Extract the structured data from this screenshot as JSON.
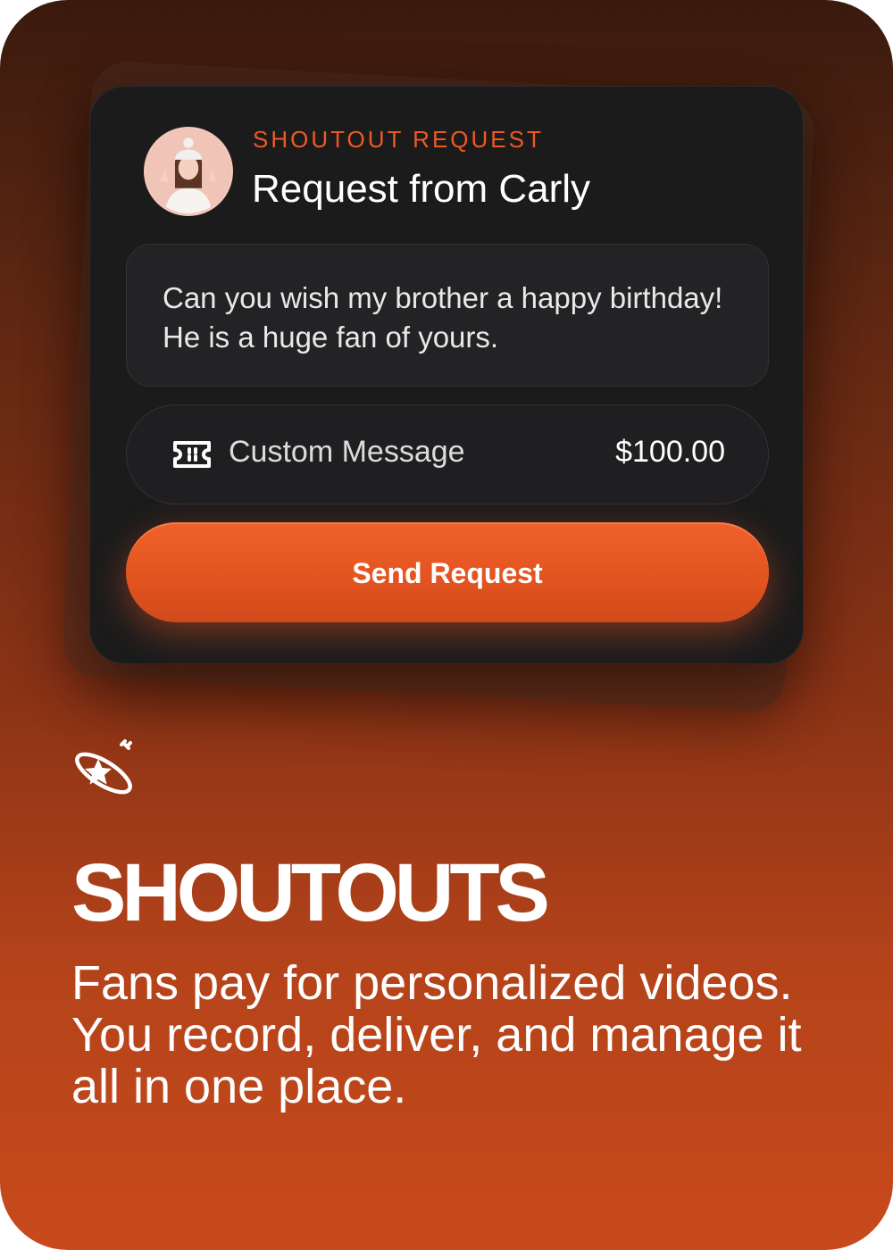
{
  "card": {
    "eyebrow": "SHOUTOUT REQUEST",
    "title": "Request from Carly",
    "message": "Can you wish my brother a happy birthday! He is a huge fan of yours.",
    "product": {
      "icon": "ticket-icon",
      "label": "Custom Message",
      "price": "$100.00"
    },
    "send_label": "Send Request"
  },
  "feature": {
    "icon": "star-orbit-icon",
    "title": "SHOUTOUTS",
    "description": "Fans pay for personalized videos. You record, deliver, and manage it all in one place."
  },
  "colors": {
    "accent": "#EC5A24",
    "card_bg": "#1B1B1C",
    "page_top": "#3A1A0E",
    "page_bottom": "#C84A1C"
  }
}
